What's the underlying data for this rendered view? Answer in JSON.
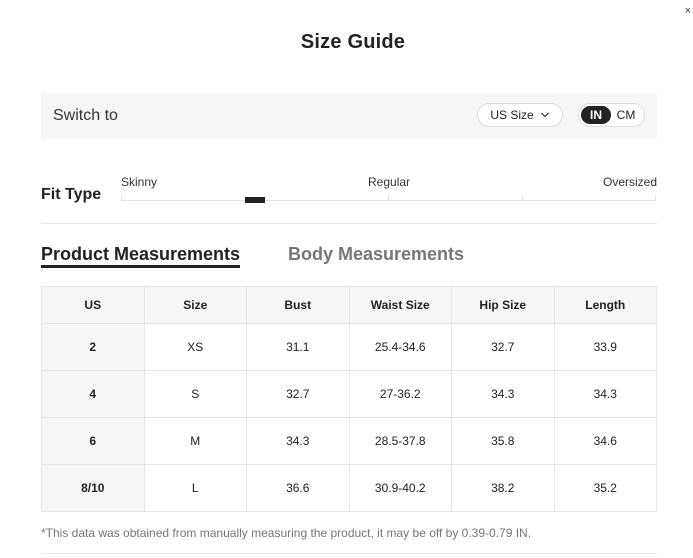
{
  "title": "Size Guide",
  "close_glyph": "×",
  "switch_bar": {
    "label": "Switch to",
    "size_system": "US Size",
    "units": {
      "options": [
        "IN",
        "CM"
      ],
      "selected": "IN"
    }
  },
  "fit_type": {
    "label": "Fit Type",
    "scale": [
      "Skinny",
      "Regular",
      "Oversized"
    ],
    "value_fraction": 0.25
  },
  "tabs": [
    {
      "label": "Product Measurements",
      "active": true
    },
    {
      "label": "Body Measurements",
      "active": false
    }
  ],
  "table": {
    "headers": [
      "US",
      "Size",
      "Bust",
      "Waist Size",
      "Hip Size",
      "Length"
    ],
    "rows": [
      [
        "2",
        "XS",
        "31.1",
        "25.4-34.6",
        "32.7",
        "33.9"
      ],
      [
        "4",
        "S",
        "32.7",
        "27-36.2",
        "34.3",
        "34.3"
      ],
      [
        "6",
        "M",
        "34.3",
        "28.5-37.8",
        "35.8",
        "34.6"
      ],
      [
        "8/10",
        "L",
        "36.6",
        "30.9-40.2",
        "38.2",
        "35.2"
      ]
    ]
  },
  "note": "*This data was obtained from manually measuring the product, it may be off by 0.39-0.79 IN."
}
